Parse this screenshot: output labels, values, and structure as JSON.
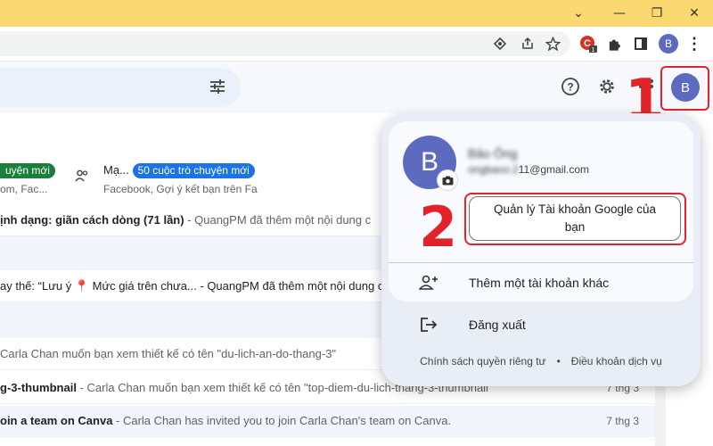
{
  "browser": {
    "window_controls": [
      "chevron-down",
      "minimize",
      "restore",
      "close"
    ],
    "profile_initial": "B",
    "extension_badge": "1",
    "accent": "#fbd870"
  },
  "gmail": {
    "profile_initial": "B",
    "categories": [
      {
        "label": "uyện mới",
        "sub": "om, Fac...",
        "badge_color": "#188038"
      },
      {
        "label": "Mạ...",
        "badge": "50 cuộc trò chuyện mới",
        "sub": "Facebook, Gợi ý kết bạn trên Fa",
        "badge_color": "#1a73e8"
      }
    ],
    "emails": [
      {
        "subject": "ịnh dạng: giãn cách dòng (71 lần)",
        "snippet": " - QuangPM đã thêm một nội dung c",
        "date": ""
      },
      {
        "subject": "",
        "snippet": "ay thế: “Lưu ý 📍 Mức giá trên chưa... - QuangPM đã thêm một nội dung c",
        "date": ""
      },
      {
        "subject": "",
        "snippet": "Carla Chan muốn bạn xem thiết kế có tên \"du-lich-an-do-thang-3\"",
        "date": ""
      },
      {
        "subject": "g-3-thumbnail",
        "snippet": " - Carla Chan muốn bạn xem thiết kế có tên \"top-diem-du-lich-thang-3-thumbnail",
        "date": "7 thg 3"
      },
      {
        "subject": "oin a team on Canva",
        "snippet": " - Carla Chan has invited you to join Carla Chan's team on Canva.",
        "date": "7 thg 3"
      }
    ]
  },
  "account_menu": {
    "avatar_initial": "B",
    "name": "Bảo Ông",
    "email_hidden": "ongbaoo.2",
    "email_visible": "11@gmail.com",
    "manage_button": "Quản lý Tài khoản Google của bạn",
    "add_account": "Thêm một tài khoản khác",
    "sign_out": "Đăng xuất",
    "privacy": "Chính sách quyền riêng tư",
    "separator": "•",
    "terms": "Điều khoản dịch vụ"
  },
  "annotations": {
    "step1": "1",
    "step2": "2",
    "color": "#e2242a"
  }
}
